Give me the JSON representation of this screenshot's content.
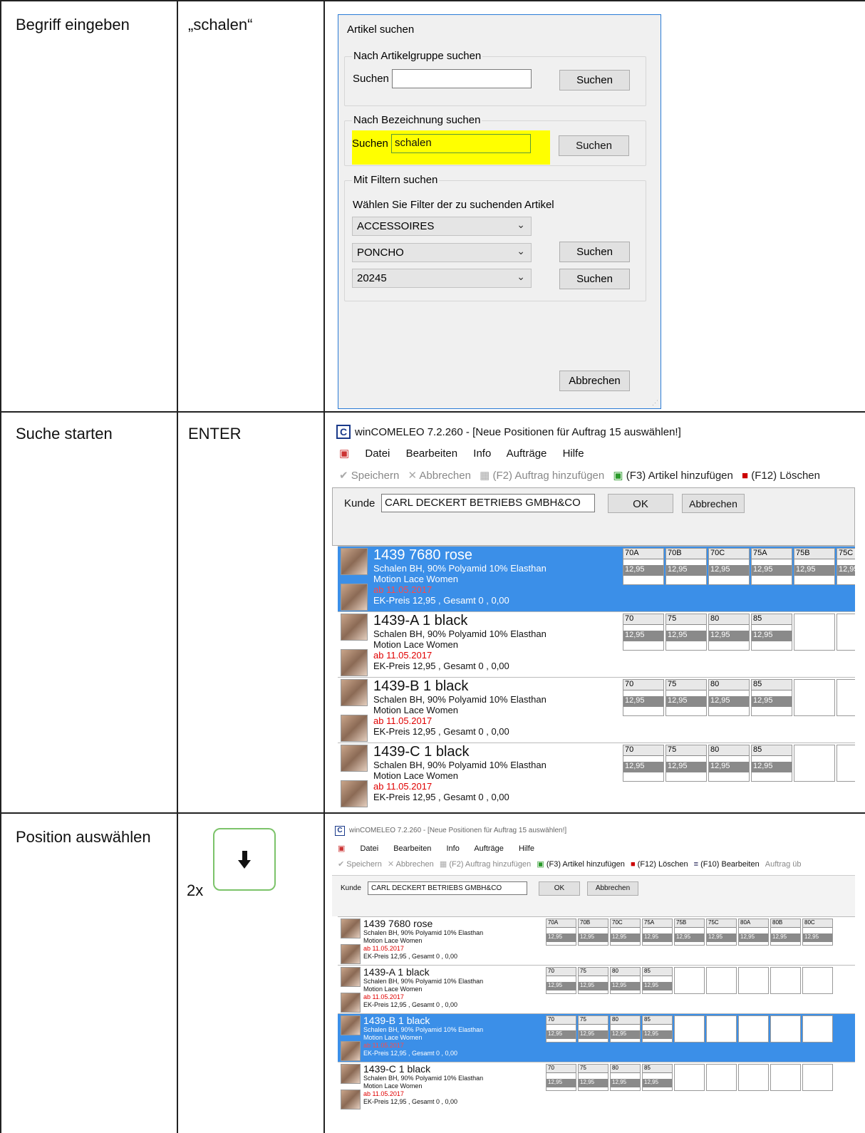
{
  "table": {
    "rows": [
      {
        "step": "Begriff eingeben",
        "action": "„schalen“"
      },
      {
        "step": "Suche starten",
        "action": "ENTER"
      },
      {
        "step": "Position auswählen",
        "action_prefix": "2x",
        "action_icon": "arrow-down-key-icon"
      }
    ]
  },
  "dialog": {
    "title": "Artikel suchen",
    "group1": {
      "legend": "Nach Artikelgruppe suchen",
      "label": "Suchen",
      "value": "",
      "button": "Suchen"
    },
    "group2": {
      "legend": "Nach Bezeichnung suchen",
      "label": "Suchen",
      "value": "schalen",
      "button": "Suchen"
    },
    "group3": {
      "legend": "Mit Filtern suchen",
      "hint": "Wählen Sie Filter der zu suchenden Artikel",
      "select1": "ACCESSOIRES",
      "select2": "PONCHO",
      "select3": "20245",
      "button2": "Suchen",
      "button3": "Suchen"
    },
    "cancel": "Abbrechen",
    "highlight_color": "#ffff00"
  },
  "app": {
    "title": "winCOMELEO 7.2.260 - [Neue Positionen für Auftrag 15 auswählen!]",
    "menu": [
      "Datei",
      "Bearbeiten",
      "Info",
      "Aufträge",
      "Hilfe"
    ],
    "toolbar": {
      "save": "Speichern",
      "cancel": "Abbrechen",
      "add_order": "(F2) Auftrag hinzufügen",
      "add_article": "(F3) Artikel hinzufügen",
      "delete": "(F12) Löschen",
      "edit": "(F10) Bearbeiten",
      "order_more": "Auftrag üb"
    },
    "customer_label": "Kunde",
    "customer_value": "CARL DECKERT BETRIEBS GMBH&CO",
    "ok": "OK",
    "abort": "Abbrechen",
    "selection_color": "#3b8fe8",
    "articles": [
      {
        "code": "1439",
        "color": "7680 rose",
        "desc": "Schalen BH, 90% Polyamid 10% Elasthan",
        "line": "Motion Lace Women",
        "date": "ab 11.05.2017",
        "price": "EK-Preis 12,95 , Gesamt 0 ,  0,00",
        "sizes": [
          "70A",
          "70B",
          "70C",
          "75A",
          "75B",
          "75C",
          "80A",
          "80B",
          "80C"
        ],
        "size_price": "12,95"
      },
      {
        "code": "1439-A",
        "color": "1 black",
        "desc": "Schalen BH, 90% Polyamid 10% Elasthan",
        "line": "Motion Lace Women",
        "date": "ab 11.05.2017",
        "price": "EK-Preis 12,95 , Gesamt 0 ,  0,00",
        "sizes": [
          "70",
          "75",
          "80",
          "85"
        ],
        "size_price": "12,95"
      },
      {
        "code": "1439-B",
        "color": "1 black",
        "desc": "Schalen BH, 90% Polyamid 10% Elasthan",
        "line": "Motion Lace Women",
        "date": "ab 11.05.2017",
        "price": "EK-Preis 12,95 , Gesamt 0 ,  0,00",
        "sizes": [
          "70",
          "75",
          "80",
          "85"
        ],
        "size_price": "12,95"
      },
      {
        "code": "1439-C",
        "color": "1 black",
        "desc": "Schalen BH, 90% Polyamid 10% Elasthan",
        "line": "Motion Lace Women",
        "date": "ab 11.05.2017",
        "price": "EK-Preis 12,95 , Gesamt 0 ,  0,00",
        "sizes": [
          "70",
          "75",
          "80",
          "85"
        ],
        "size_price": "12,95"
      }
    ]
  }
}
